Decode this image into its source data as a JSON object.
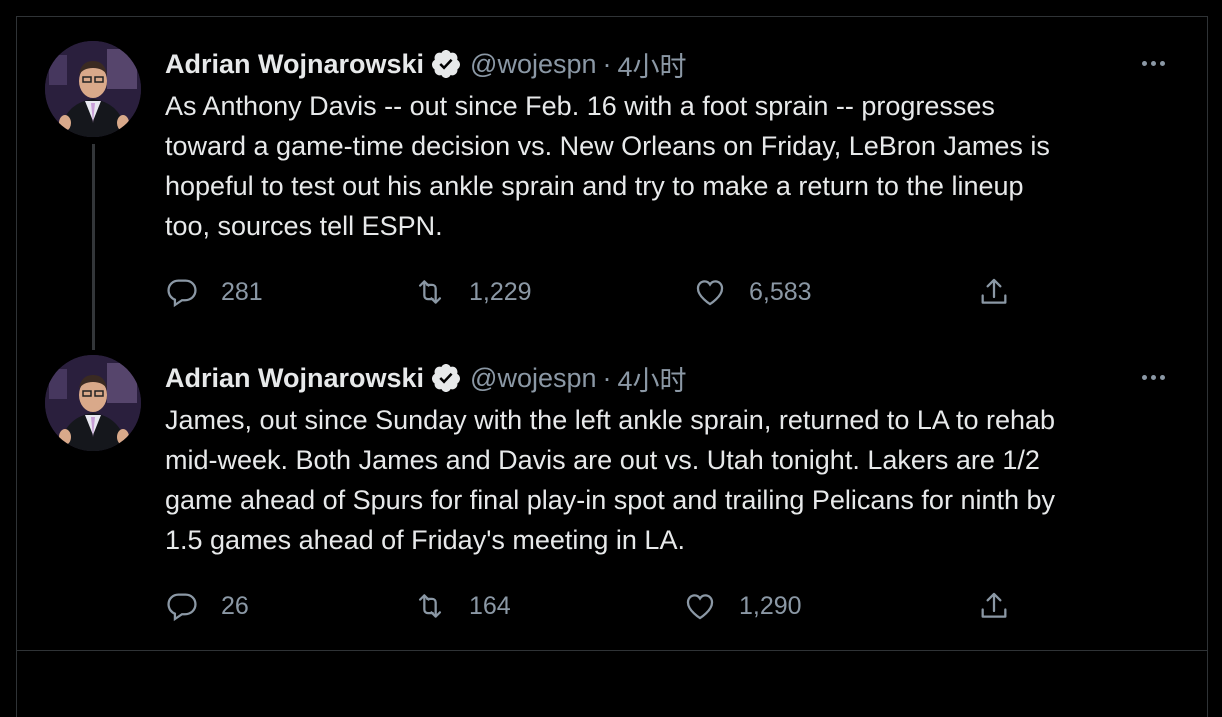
{
  "tweets": [
    {
      "author_name": "Adrian Wojnarowski",
      "handle": "@wojespn",
      "separator": "·",
      "time": "4小时",
      "text": "As Anthony Davis -- out since Feb. 16 with a foot sprain -- progresses\ntoward a game-time decision vs. New Orleans on Friday, LeBron James is\nhopeful to test out his ankle sprain and try to make a return to the lineup\ntoo, sources tell ESPN.",
      "replies": "281",
      "retweets": "1,229",
      "likes": "6,583"
    },
    {
      "author_name": "Adrian Wojnarowski",
      "handle": "@wojespn",
      "separator": "·",
      "time": "4小时",
      "text": "James, out since Sunday with the left ankle sprain, returned to LA to rehab\nmid-week. Both James and Davis are out vs. Utah tonight. Lakers are 1/2\ngame ahead of Spurs for final play-in spot and trailing Pelicans for ninth by\n1.5 games ahead of Friday's meeting in LA.",
      "replies": "26",
      "retweets": "164",
      "likes": "1,290"
    }
  ],
  "colors": {
    "background": "#000000",
    "text": "#e7e9ea",
    "muted": "#8b98a5",
    "border": "#2f3336",
    "verified_badge": "#e7e9ea"
  },
  "icons": [
    "verified-badge-icon",
    "more-icon",
    "reply-icon",
    "retweet-icon",
    "like-icon",
    "share-icon"
  ]
}
